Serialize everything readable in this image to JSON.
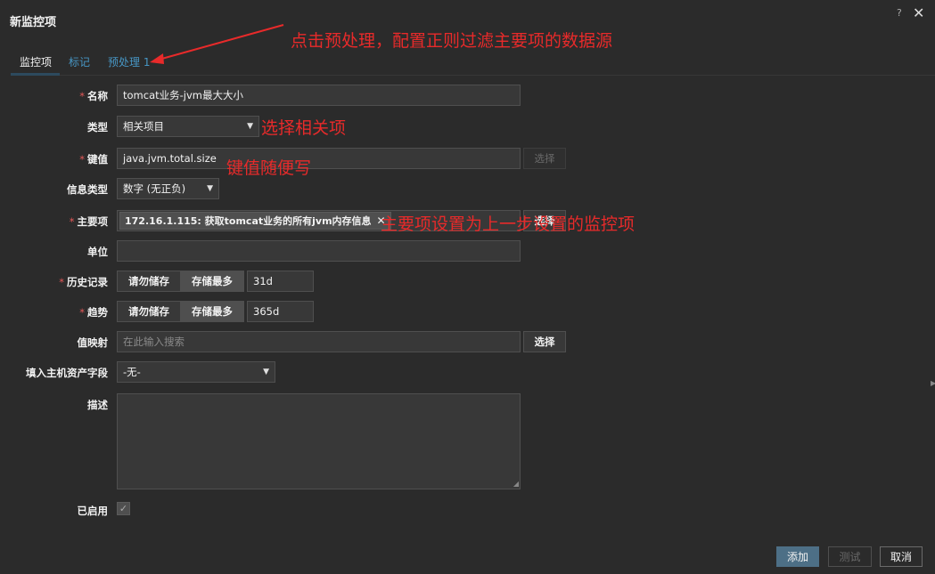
{
  "dialog": {
    "title": "新监控项",
    "help": "?",
    "close": "✕"
  },
  "tabs": [
    {
      "label": "监控项"
    },
    {
      "label": "标记"
    },
    {
      "label": "预处理 1"
    }
  ],
  "form": {
    "name_label": "名称",
    "name_value": "tomcat业务-jvm最大大小",
    "type_label": "类型",
    "type_value": "相关项目",
    "key_label": "键值",
    "key_value": "java.jvm.total.size",
    "key_select_button": "选择",
    "info_type_label": "信息类型",
    "info_type_value": "数字 (无正负)",
    "master_item_label": "主要项",
    "master_item_tag": "172.16.1.115: 获取tomcat业务的所有jvm内存信息",
    "master_item_select_button": "选择",
    "units_label": "单位",
    "units_value": "",
    "history_label": "历史记录",
    "history_options": [
      "请勿储存",
      "存储最多"
    ],
    "history_value": "31d",
    "trends_label": "趋势",
    "trends_options": [
      "请勿储存",
      "存储最多"
    ],
    "trends_value": "365d",
    "valuemap_label": "值映射",
    "valuemap_placeholder": "在此输入搜索",
    "valuemap_select_button": "选择",
    "inventory_label": "填入主机资产字段",
    "inventory_value": "-无-",
    "description_label": "描述",
    "enabled_label": "已启用",
    "enabled": true
  },
  "footer": {
    "add": "添加",
    "test": "测试",
    "cancel": "取消"
  },
  "annotations": {
    "a1": "点击预处理，配置正则过滤主要项的数据源",
    "a2": "选择相关项",
    "a3": "键值随便写",
    "a4": "主要项设置为上一步设置的监控项"
  },
  "colors": {
    "background": "#2b2b2b",
    "accent": "#4796c4",
    "primary_button": "#4d6f86",
    "annotation": "#e82a2a",
    "required": "#e45959"
  }
}
